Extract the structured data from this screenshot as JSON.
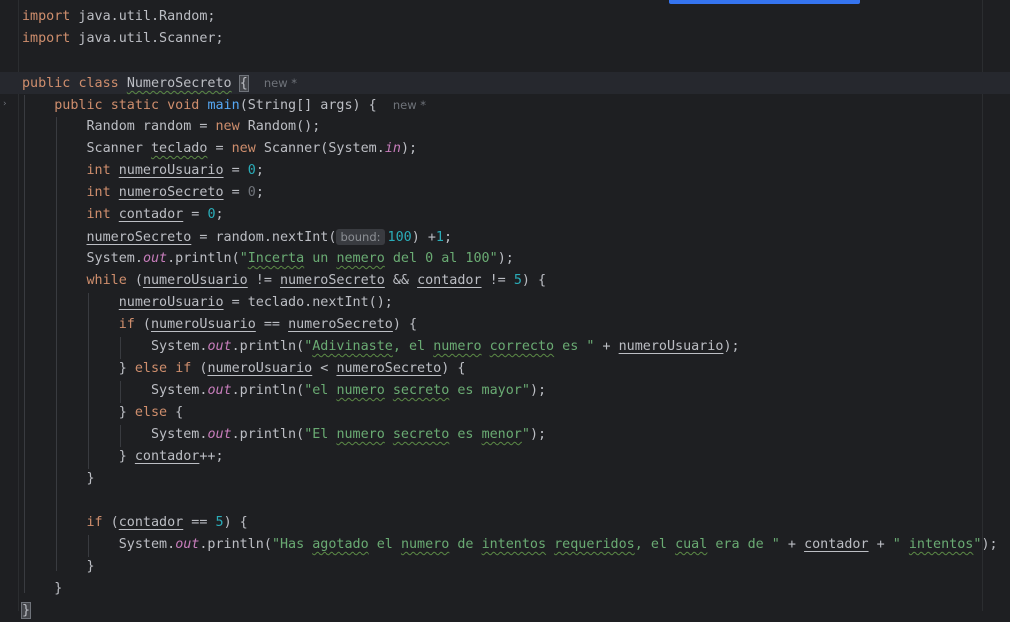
{
  "editor": {
    "lines": {
      "l1": {
        "kw": "import",
        "rest": " java.util.Random;"
      },
      "l2": {
        "kw": "import",
        "rest": " java.util.Scanner;"
      },
      "l4": {
        "kw1": "public",
        "kw2": "class",
        "name": "NumeroSecreto",
        "brace": "{",
        "hint": "new *"
      },
      "l5": {
        "kw1": "public",
        "kw2": "static",
        "kw3": "void",
        "fn": "main",
        "args": "(String[] args) {",
        "hint": "new *"
      },
      "l6": {
        "a": "Random random = ",
        "kw": "new",
        "b": " Random();"
      },
      "l7": {
        "a": "Scanner ",
        "var": "teclado",
        "b": " = ",
        "kw": "new",
        "c": " Scanner(System.",
        "fld": "in",
        "d": ");"
      },
      "l8": {
        "kw": "int",
        "var": "numeroUsuario",
        "b": " = ",
        "num": "0",
        "c": ";"
      },
      "l9": {
        "kw": "int",
        "var": "numeroSecreto",
        "b": " = ",
        "num": "0",
        "c": ";"
      },
      "l10": {
        "kw": "int",
        "var": "contador",
        "b": " = ",
        "num": "0",
        "c": ";"
      },
      "l11": {
        "var": "numeroSecreto",
        "b": " = random.nextInt(",
        "inlay": "bound:",
        "num": "100",
        "c": ") +",
        "num2": "1",
        "d": ";"
      },
      "l12": {
        "a": "System.",
        "fld": "out",
        "b": ".println(",
        "s1": "\"",
        "w1": "Incerta",
        "s2": " un ",
        "w2": "nemero",
        "s3": " del 0 al 100\"",
        "c": ");"
      },
      "l13": {
        "kw": "while",
        "a": " (",
        "v1": "numeroUsuario",
        "b": " != ",
        "v2": "numeroSecreto",
        "c": " && ",
        "v3": "contador",
        "d": " != ",
        "num": "5",
        "e": ") {"
      },
      "l14": {
        "var": "numeroUsuario",
        "b": " = teclado.nextInt();"
      },
      "l15": {
        "kw": "if",
        "a": " (",
        "v1": "numeroUsuario",
        "b": " == ",
        "v2": "numeroSecreto",
        "c": ") {"
      },
      "l16": {
        "a": "System.",
        "fld": "out",
        "b": ".println(",
        "s1": "\"",
        "w1": "Adivinaste",
        "s2": ", el ",
        "w2": "numero",
        "s3": " ",
        "w3": "correcto",
        "s4": " es \"",
        "c": " + ",
        "var": "numeroUsuario",
        "d": ");"
      },
      "l17": {
        "a": "} ",
        "kw1": "else",
        "b": " ",
        "kw2": "if",
        "c": " (",
        "v1": "numeroUsuario",
        "d": " < ",
        "v2": "numeroSecreto",
        "e": ") {"
      },
      "l18": {
        "a": "System.",
        "fld": "out",
        "b": ".println(",
        "s1": "\"el ",
        "w1": "numero",
        "s2": " ",
        "w2": "secreto",
        "s3": " es mayor\"",
        "c": ");"
      },
      "l19": {
        "a": "} ",
        "kw": "else",
        "b": " {"
      },
      "l20": {
        "a": "System.",
        "fld": "out",
        "b": ".println(",
        "s1": "\"El ",
        "w1": "numero",
        "s2": " ",
        "w2": "secreto",
        "s3": " es ",
        "w3": "menor",
        "s4": "\"",
        "c": ");"
      },
      "l21": {
        "a": "} ",
        "var": "contador",
        "b": "++;"
      },
      "l22": {
        "a": "}"
      },
      "l24": {
        "kw": "if",
        "a": " (",
        "var": "contador",
        "b": " == ",
        "num": "5",
        "c": ") {"
      },
      "l25": {
        "a": "System.",
        "fld": "out",
        "b": ".println(",
        "s1": "\"Has ",
        "w1": "agotado",
        "s2": " el ",
        "w2": "numero",
        "s3": " de ",
        "w3": "intentos",
        "s4": " ",
        "w4": "requeridos",
        "s5": ", el ",
        "w5": "cual",
        "s6": " era de \"",
        "c": " + ",
        "var": "contador",
        "d": " + ",
        "s7": "\" ",
        "w6": "intentos",
        "s8": "\"",
        "e": ");"
      },
      "l26": {
        "a": "}"
      },
      "l27": {
        "a": "}"
      },
      "l28": {
        "a": "}"
      }
    }
  }
}
